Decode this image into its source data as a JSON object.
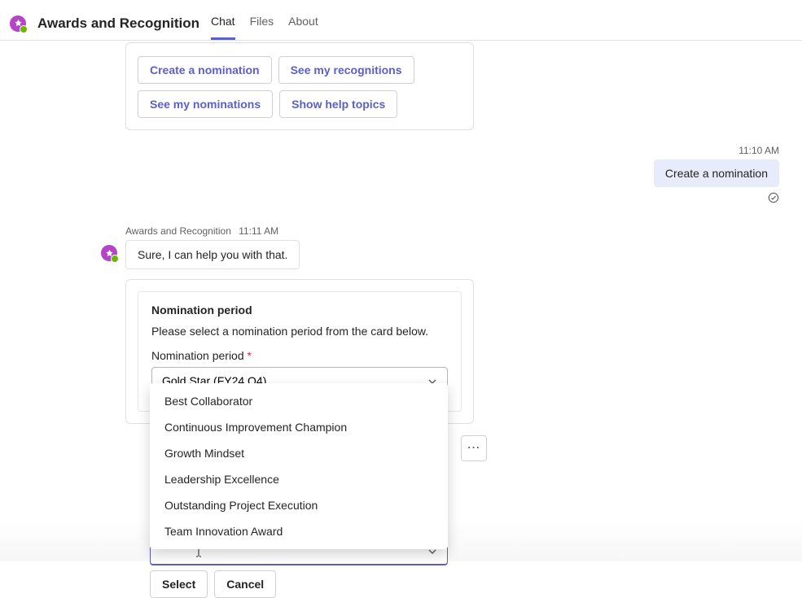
{
  "header": {
    "app_title": "Awards and Recognition",
    "tabs": {
      "chat": "Chat",
      "files": "Files",
      "about": "About"
    }
  },
  "quick_actions": {
    "create_nomination": "Create a nomination",
    "see_recognitions": "See my recognitions",
    "see_nominations": "See my nominations",
    "show_help": "Show help topics"
  },
  "user_msg": {
    "timestamp": "11:10 AM",
    "text": "Create a nomination"
  },
  "bot_meta": {
    "name": "Awards and Recognition",
    "time": "11:11 AM"
  },
  "bot_reply": "Sure, I can help you with that.",
  "form": {
    "title": "Nomination period",
    "description": "Please select a nomination period from the card below.",
    "label": "Nomination period",
    "required_mark": "*",
    "selected_value": "Gold Star (FY24 Q4)"
  },
  "dropdown_options": [
    "Best Collaborator",
    "Continuous Improvement Champion",
    "Growth Mindset",
    "Leadership Excellence",
    "Outstanding Project Execution",
    "Team Innovation Award"
  ],
  "actions": {
    "select": "Select",
    "cancel": "Cancel"
  },
  "more_glyph": "⋯"
}
